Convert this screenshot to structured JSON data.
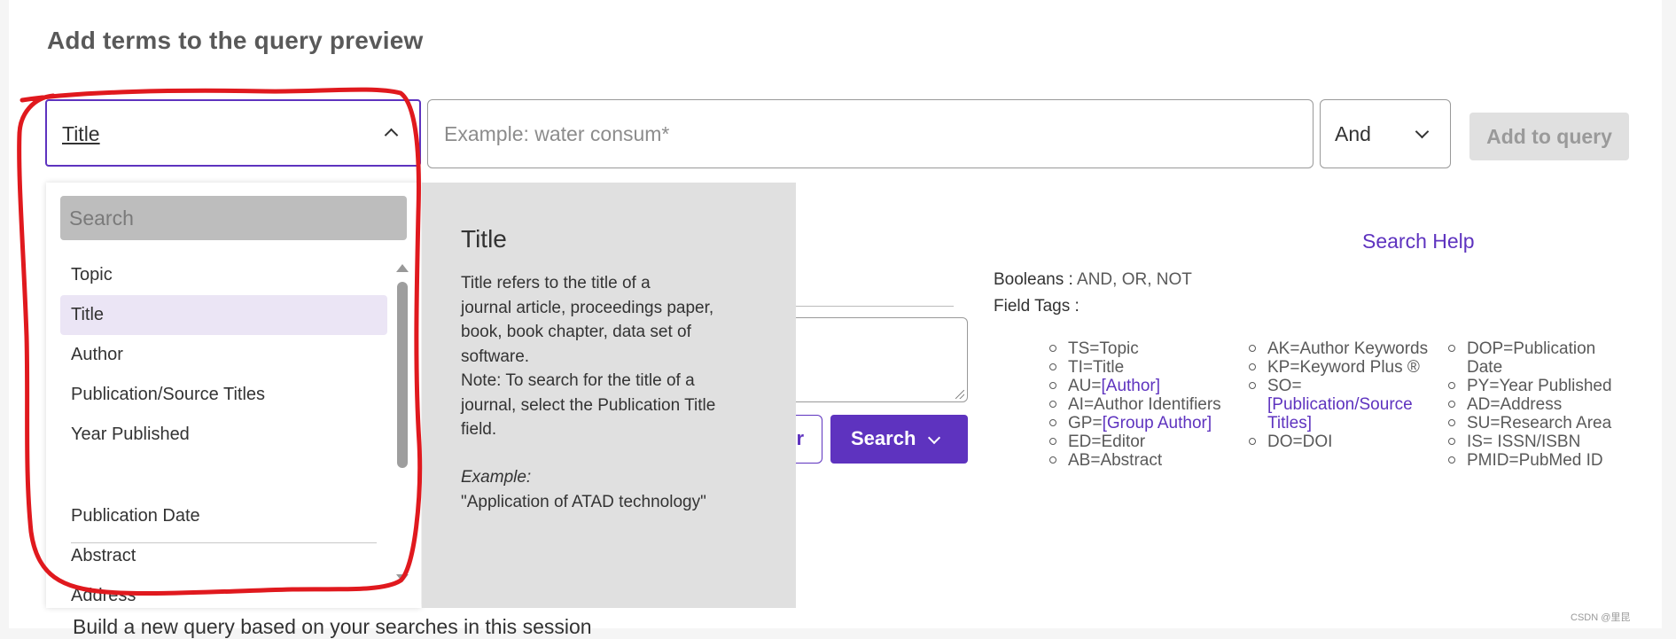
{
  "heading": "Add terms to the query preview",
  "field_select": {
    "value": "Title"
  },
  "query_input": {
    "placeholder": "Example: water consum*",
    "value": ""
  },
  "operator_select": {
    "value": "And"
  },
  "add_button": "Add to query",
  "dropdown": {
    "search_placeholder": "Search",
    "items": [
      {
        "label": "Topic",
        "active": false
      },
      {
        "label": "Title",
        "active": true
      },
      {
        "label": "Author",
        "active": false
      },
      {
        "label": "Publication/Source Titles",
        "active": false
      },
      {
        "label": "Year Published",
        "active": false
      },
      {
        "label": "Publication Date",
        "active": false
      },
      {
        "label": "Abstract",
        "active": false
      },
      {
        "label": "Address",
        "active": false
      }
    ]
  },
  "tooltip": {
    "title": "Title",
    "body_lines": [
      "Title refers to the title of a",
      "journal article, proceedings paper,",
      "book, book chapter, data set of",
      "software.",
      "Note: To search for the title of a",
      "journal, select the Publication Title",
      "field."
    ],
    "example_label": "Example:",
    "example_value": "\"Application of ATAD technology\""
  },
  "partial_button_text": "r",
  "search_button": "Search",
  "search_help": "Search Help",
  "booleans": {
    "label": "Booleans :",
    "value": "AND, OR, NOT"
  },
  "field_tags_label": "Field Tags :",
  "field_tags": {
    "col1": [
      {
        "prefix": "TS=Topic",
        "link": ""
      },
      {
        "prefix": "TI=Title",
        "link": ""
      },
      {
        "prefix": "AU=",
        "link": "[Author]"
      },
      {
        "prefix": "AI=Author Identifiers",
        "link": ""
      },
      {
        "prefix": "GP=",
        "link": "[Group Author]"
      },
      {
        "prefix": "ED=Editor",
        "link": ""
      },
      {
        "prefix": "AB=Abstract",
        "link": ""
      }
    ],
    "col2": [
      {
        "prefix": "AK=Author Keywords",
        "link": ""
      },
      {
        "prefix": "KP=Keyword Plus ®",
        "link": ""
      },
      {
        "prefix": "SO=",
        "link": "[Publication/Source Titles]"
      },
      {
        "prefix": "DO=DOI",
        "link": ""
      }
    ],
    "col3": [
      {
        "prefix": "DOP=Publication Date",
        "link": ""
      },
      {
        "prefix": "PY=Year Published",
        "link": ""
      },
      {
        "prefix": "AD=Address",
        "link": ""
      },
      {
        "prefix": "SU=Research Area",
        "link": ""
      },
      {
        "prefix": "IS= ISSN/ISBN",
        "link": ""
      },
      {
        "prefix": "PMID=PubMed ID",
        "link": ""
      }
    ]
  },
  "bottom_text": "Build a new query based on your searches in this session",
  "watermark": "CSDN @里昆",
  "colors": {
    "accent": "#5e33bf",
    "annotation": "#e0191e",
    "active_item_bg": "#ebe5f5"
  }
}
